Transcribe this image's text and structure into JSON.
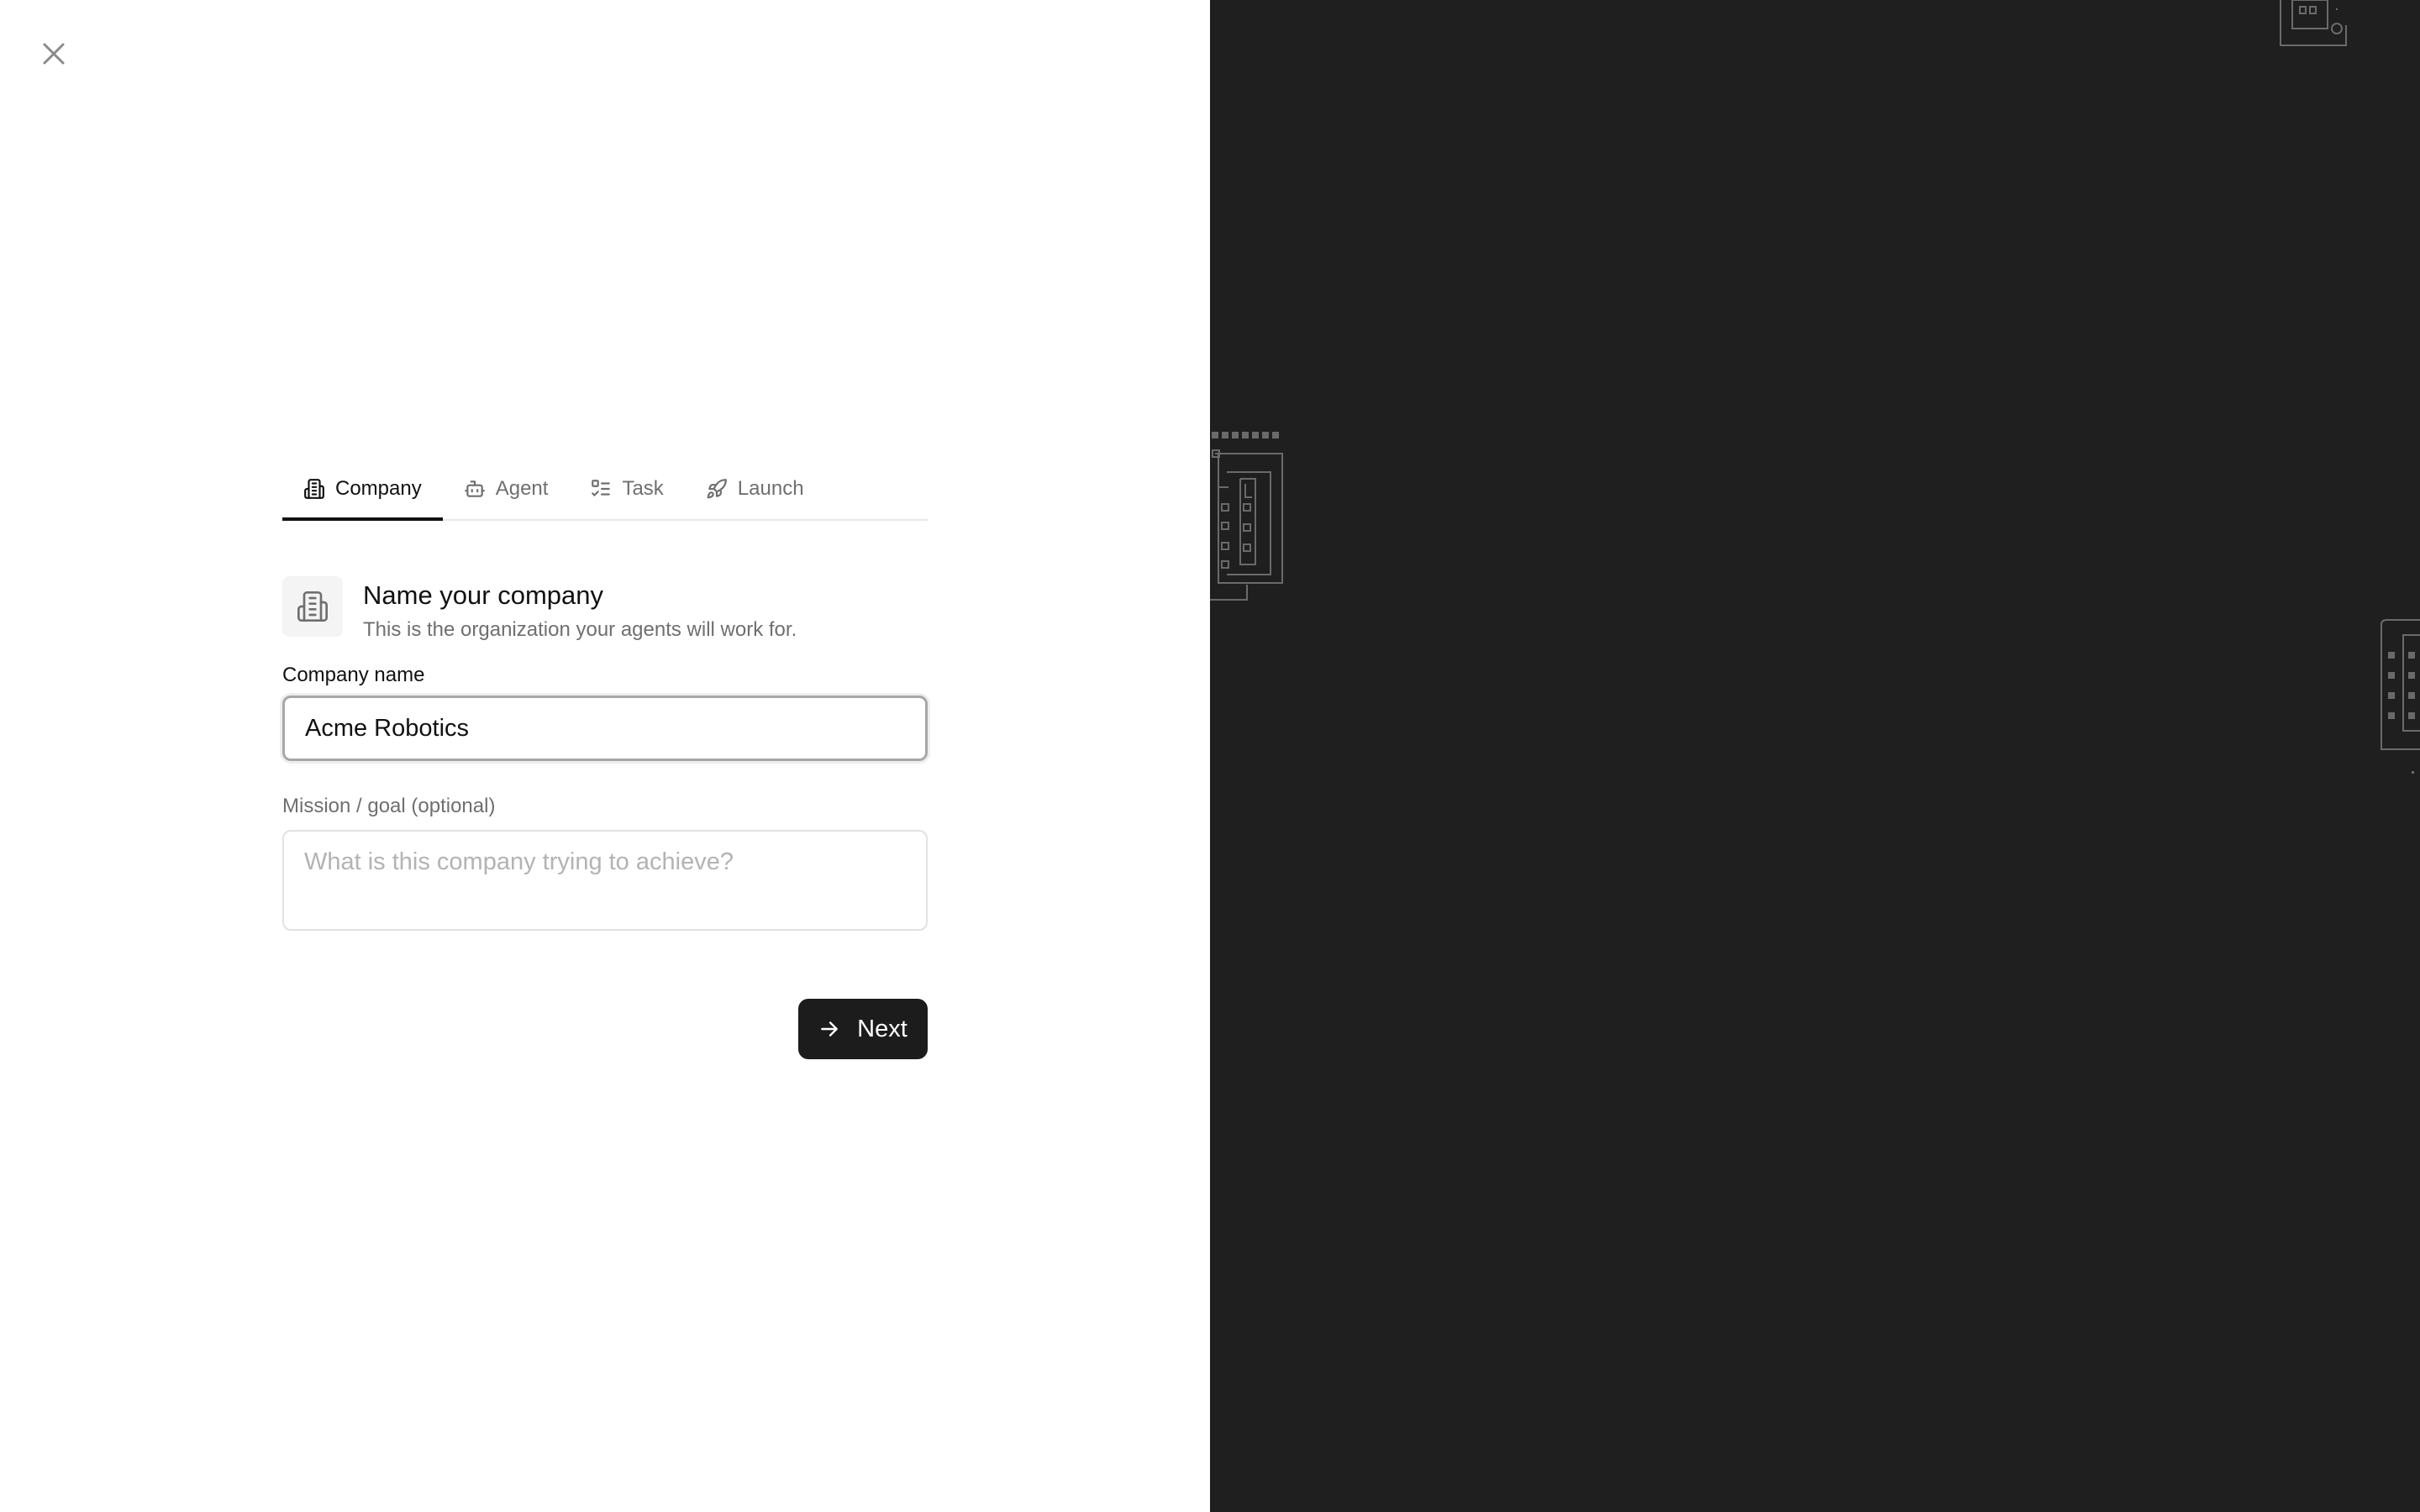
{
  "window": {
    "close_icon": "close-icon"
  },
  "tabs": [
    {
      "label": "Company",
      "icon": "building-icon",
      "active": true
    },
    {
      "label": "Agent",
      "icon": "bot-icon",
      "active": false
    },
    {
      "label": "Task",
      "icon": "list-checks-icon",
      "active": false
    },
    {
      "label": "Launch",
      "icon": "rocket-icon",
      "active": false
    }
  ],
  "step": {
    "icon": "building-icon",
    "title": "Name your company",
    "subtitle": "This is the organization your agents will work for."
  },
  "form": {
    "company_name_label": "Company name",
    "company_name_value": "Acme Robotics",
    "mission_label": "Mission / goal (optional)",
    "mission_placeholder": "What is this company trying to achieve?",
    "mission_value": ""
  },
  "actions": {
    "next_label": "Next",
    "next_icon": "arrow-right-icon"
  },
  "colors": {
    "right_panel_bg": "#1f1f1f",
    "accent": "#111111",
    "muted_text": "#6f6f6f"
  }
}
